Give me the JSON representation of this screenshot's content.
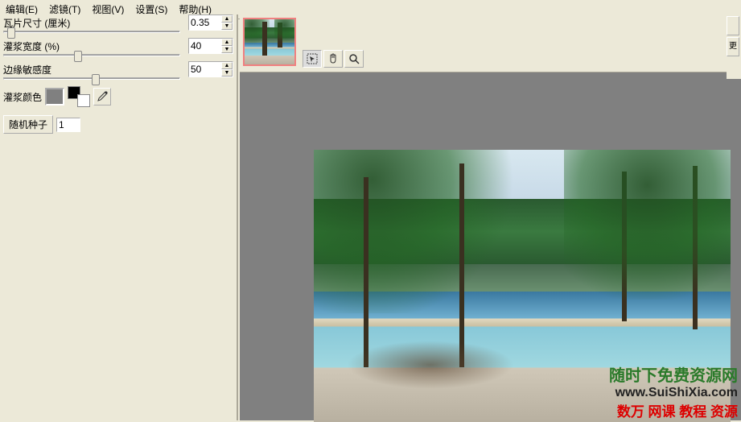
{
  "menu": {
    "edit": "编辑(E)",
    "filter": "滤镜(T)",
    "view": "视图(V)",
    "settings": "设置(S)",
    "help": "帮助(H)"
  },
  "params": {
    "tile_size_label": "瓦片尺寸 (厘米)",
    "tile_size_value": "0.35",
    "grout_width_label": "灌浆宽度 (%)",
    "grout_width_value": "40",
    "edge_sens_label": "边缘敏感度",
    "edge_sens_value": "50",
    "grout_color_label": "灌浆颜色"
  },
  "seed": {
    "button_label": "随机种子",
    "value": "1"
  },
  "tools": {
    "pointer": "pointer-icon",
    "hand": "hand-icon",
    "zoom": "zoom-icon"
  },
  "right": {
    "b1": "",
    "b2": "更"
  },
  "watermark": {
    "line1": "随时下免费资源网",
    "line2": "www.SuiShiXia.com",
    "line3": "数万 网课 教程 资源"
  }
}
